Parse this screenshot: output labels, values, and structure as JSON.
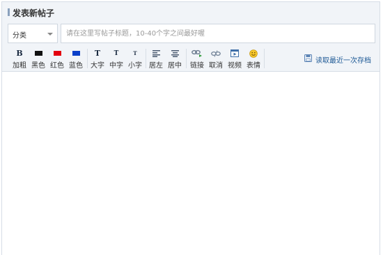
{
  "page": {
    "title": "发表新帖子"
  },
  "category": {
    "selected": "分类"
  },
  "title_input": {
    "placeholder": "请在这里写帖子标题，10-40个字之间最好喔"
  },
  "toolbar": {
    "bold": "加粗",
    "black": "黑色",
    "red": "红色",
    "blue": "蓝色",
    "big": "大字",
    "medium": "中字",
    "small": "小字",
    "align_left": "居左",
    "align_center": "居中",
    "link": "链接",
    "unlink": "取消",
    "video": "视频",
    "emoji": "表情"
  },
  "colors": {
    "black": "#111111",
    "red": "#e3000f",
    "blue": "#0a3fc9",
    "accent": "#1f5a96"
  },
  "draft": {
    "label": "读取最近一次存档"
  }
}
